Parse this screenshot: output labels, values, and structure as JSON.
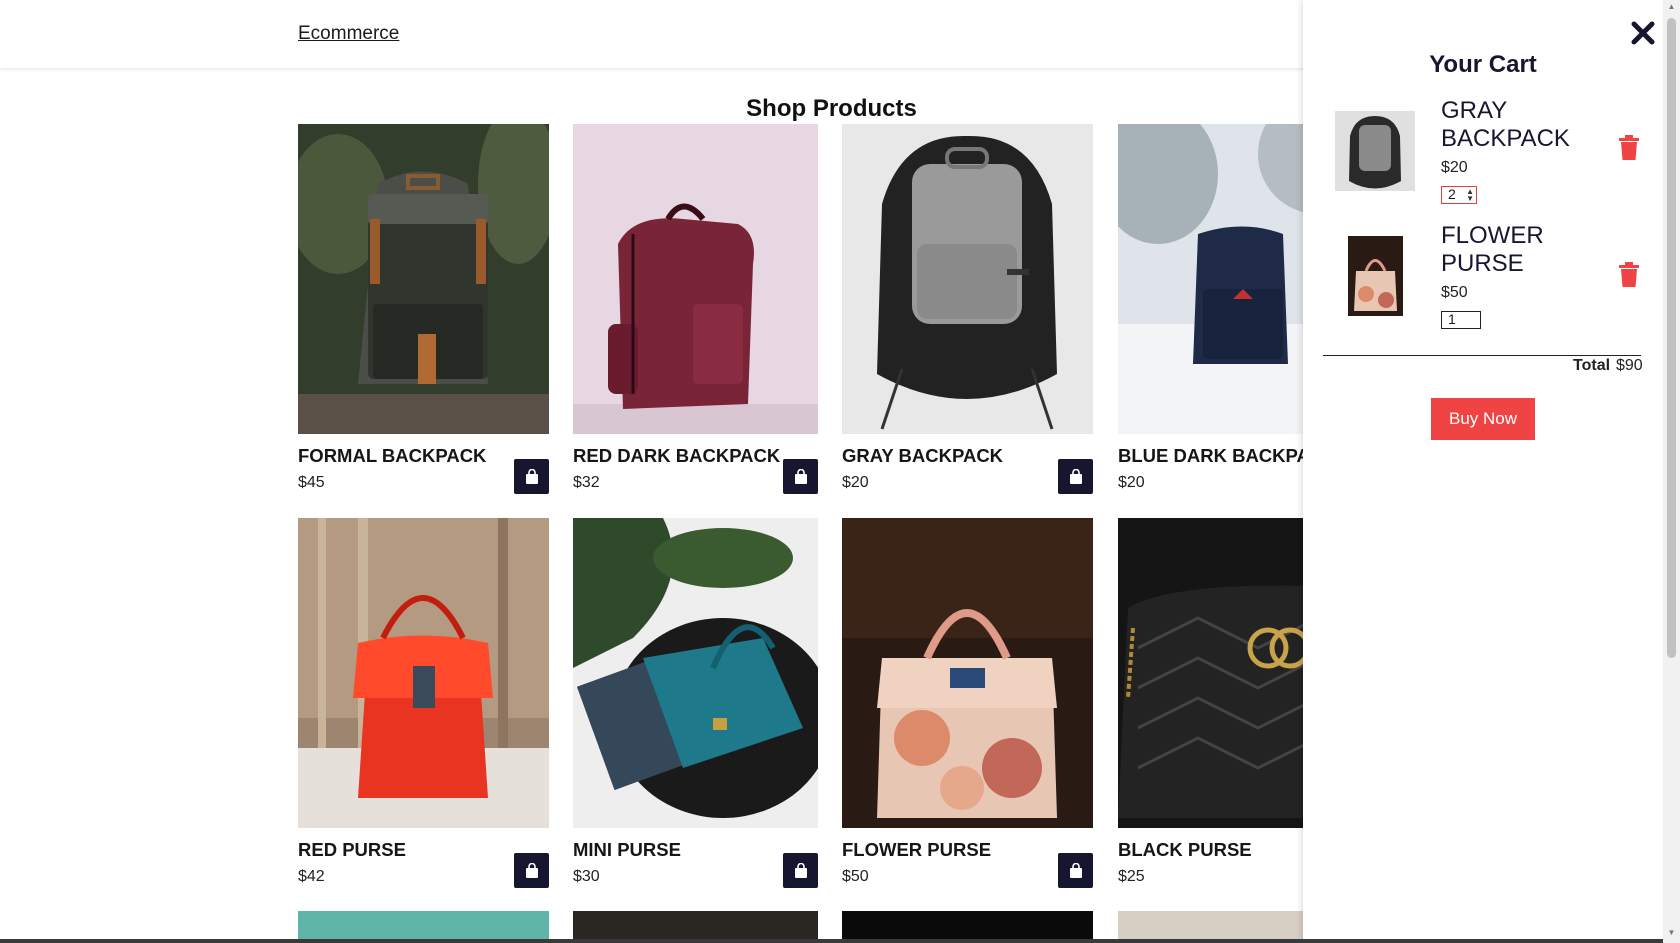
{
  "header": {
    "logo": "Ecommerce"
  },
  "main": {
    "title": "Shop Products"
  },
  "products": [
    {
      "name": "FORMAL BACKPACK",
      "price": "$45"
    },
    {
      "name": "RED DARK BACKPACK",
      "price": "$32"
    },
    {
      "name": "GRAY BACKPACK",
      "price": "$20"
    },
    {
      "name": "BLUE DARK BACKPACK",
      "price": "$20"
    },
    {
      "name": "RED PURSE",
      "price": "$42"
    },
    {
      "name": "MINI PURSE",
      "price": "$30"
    },
    {
      "name": "FLOWER PURSE",
      "price": "$50"
    },
    {
      "name": "BLACK PURSE",
      "price": "$25"
    }
  ],
  "cart": {
    "title": "Your Cart",
    "items": [
      {
        "name": "GRAY BACKPACK",
        "price": "$20",
        "quantity": "2"
      },
      {
        "name": "FLOWER PURSE",
        "price": "$50",
        "quantity": "1"
      }
    ],
    "total_label": "Total",
    "total_value": "$90",
    "buy_label": "Buy Now"
  },
  "icons": {
    "add_to_cart": "shopping-bag-icon",
    "remove": "trash-icon",
    "close": "close-icon"
  },
  "colors": {
    "accent": "#f04444",
    "dark": "#161630",
    "trash": "#f04444"
  }
}
